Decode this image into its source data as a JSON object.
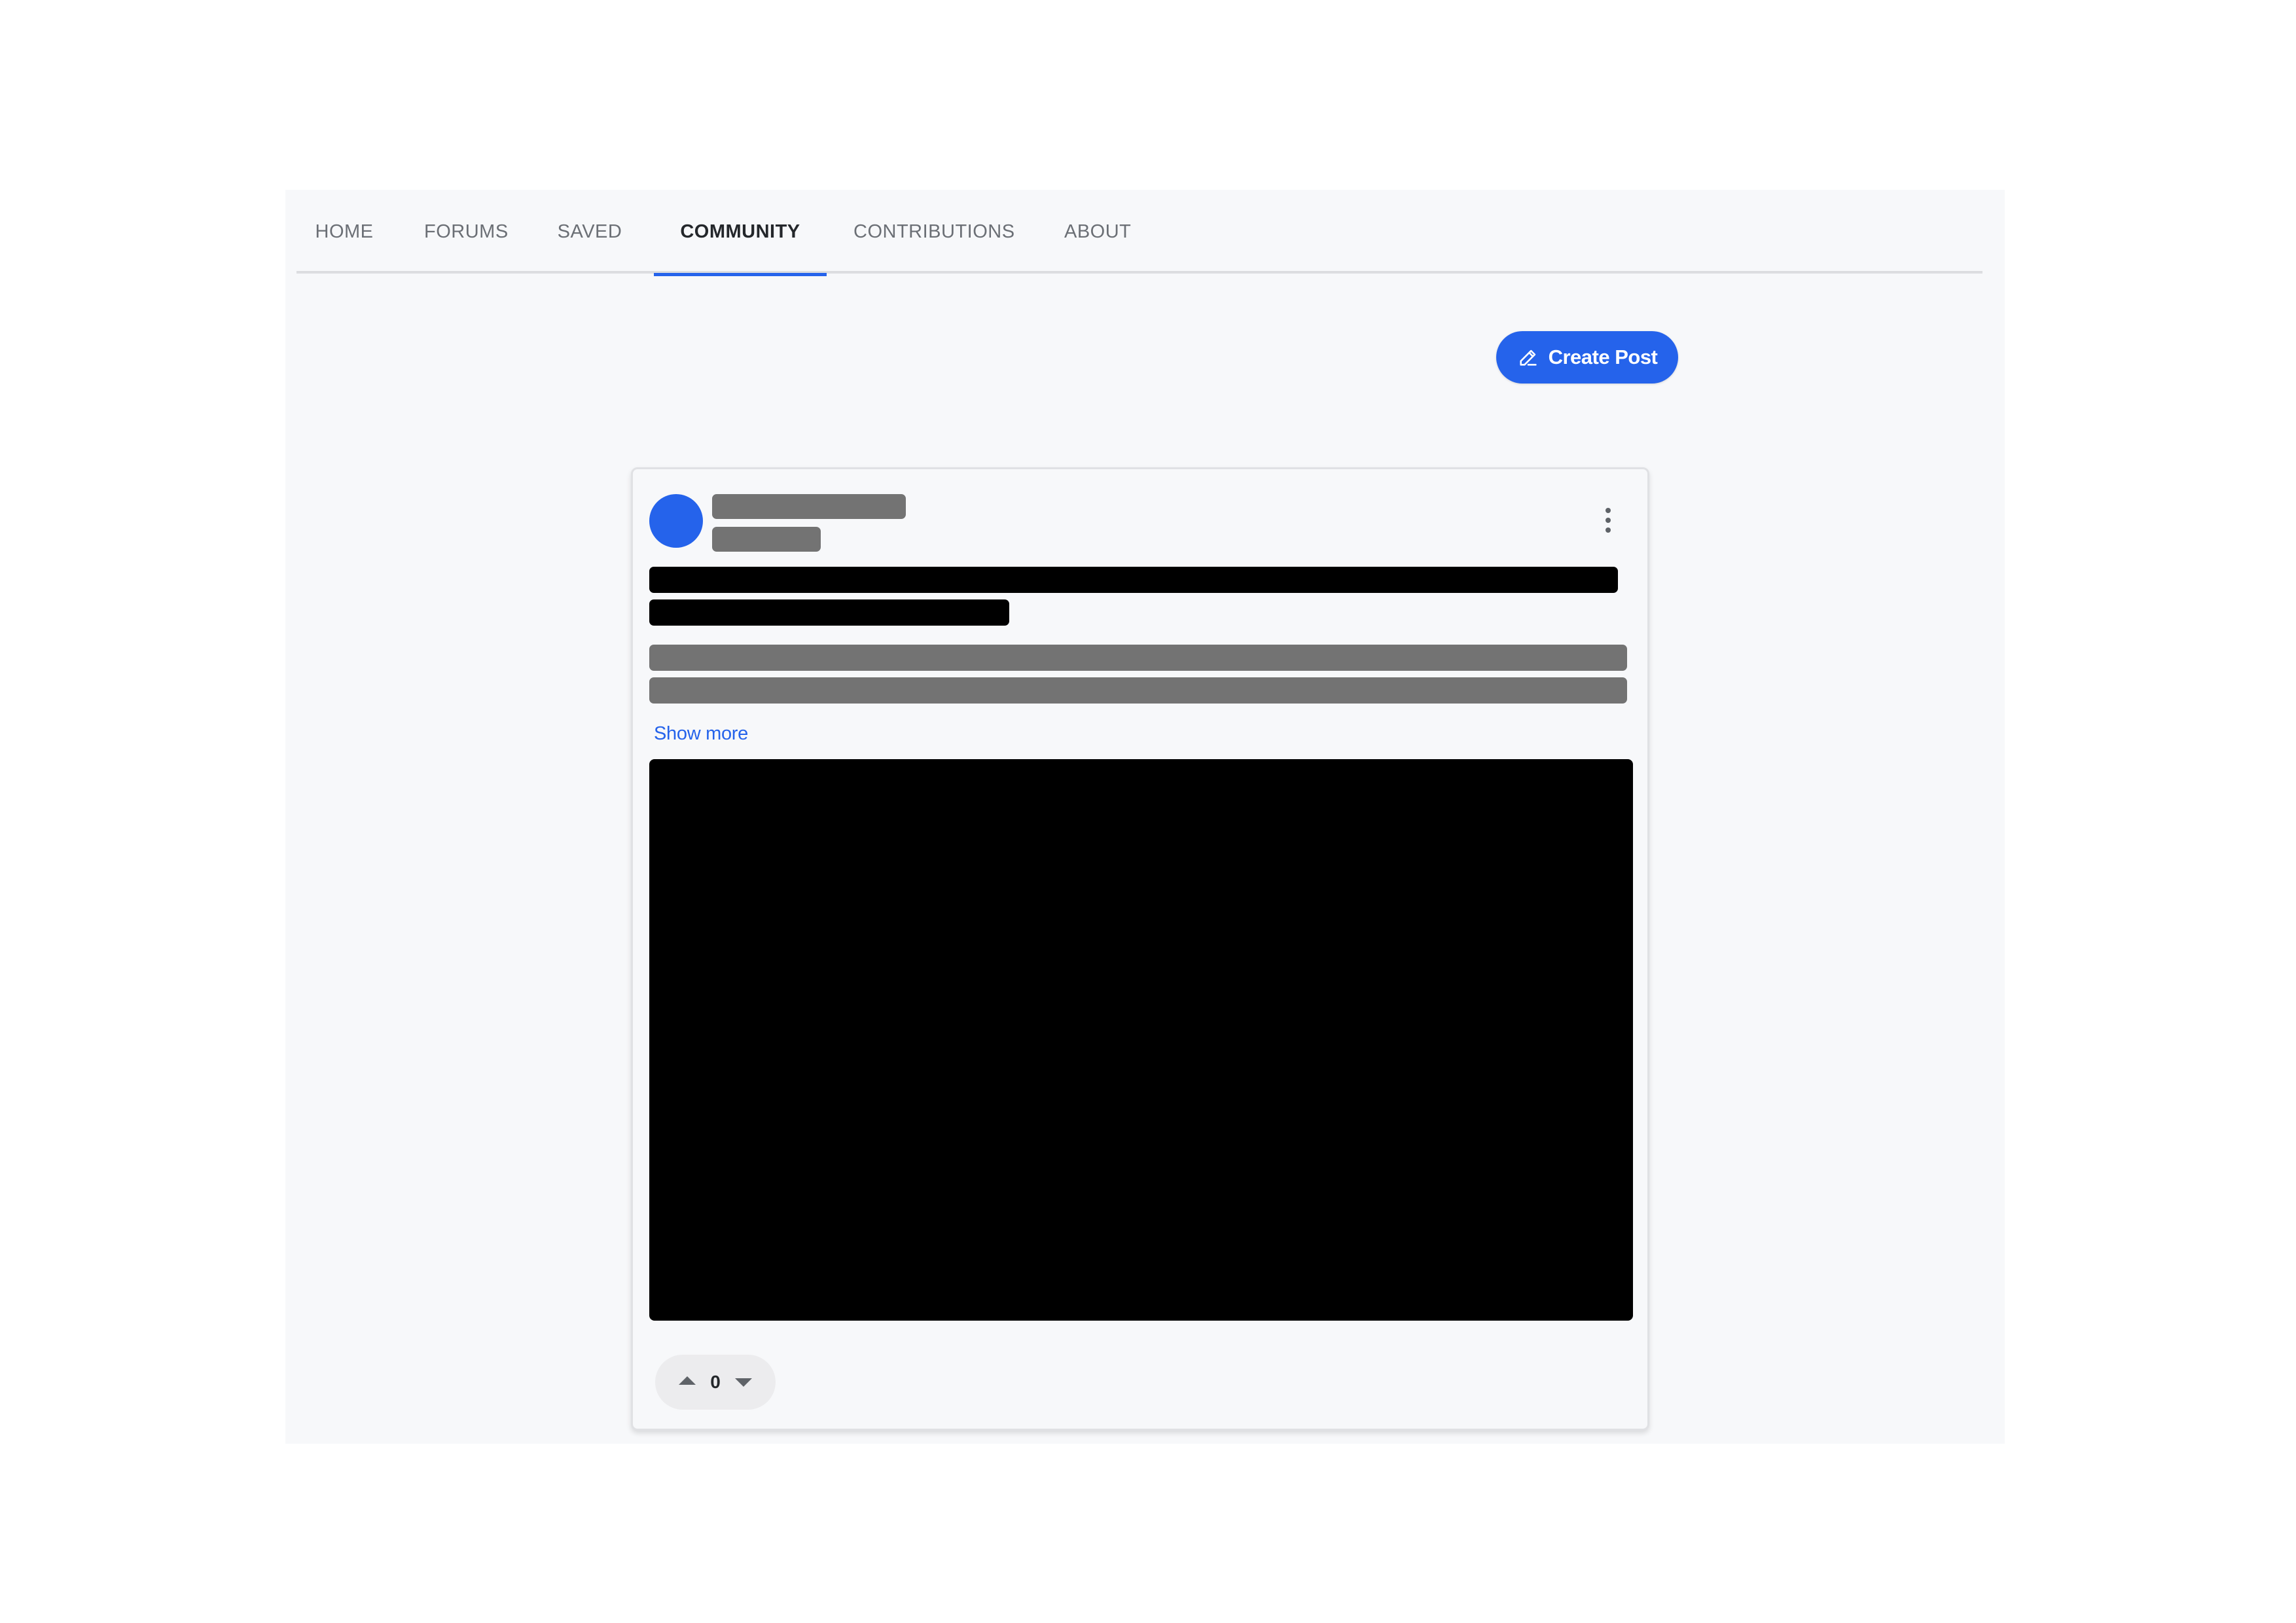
{
  "tabs": [
    {
      "label": "HOME",
      "active": false
    },
    {
      "label": "FORUMS",
      "active": false
    },
    {
      "label": "SAVED",
      "active": false
    },
    {
      "label": "COMMUNITY",
      "active": true
    },
    {
      "label": "CONTRIBUTIONS",
      "active": false
    },
    {
      "label": "ABOUT",
      "active": false
    }
  ],
  "toolbar": {
    "create_post_label": "Create Post",
    "create_post_icon": "pencil-icon"
  },
  "post": {
    "show_more_label": "Show more",
    "vote_count": "0",
    "menu_icon": "more-vertical-icon",
    "upvote_icon": "upvote-arrow-icon",
    "downvote_icon": "downvote-arrow-icon"
  },
  "colors": {
    "accent": "#2563eb",
    "background": "#f7f8fa",
    "redaction_gray": "#737373",
    "redaction_black": "#000000"
  }
}
